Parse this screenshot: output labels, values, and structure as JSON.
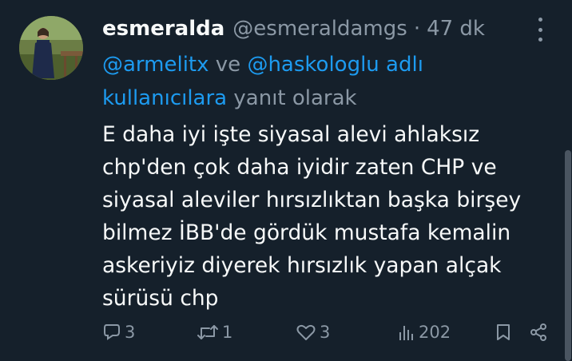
{
  "tweet": {
    "author": {
      "display_name": "esmeralda",
      "handle": "@esmeraldamgs",
      "separator": "·",
      "time": "47 dk"
    },
    "reply_context": {
      "mention_1": "@armelitx",
      "connector": " ve ",
      "mention_2": "@haskologlu adlı kullanıcılara",
      "suffix": " yanıt olarak"
    },
    "body_lines": [
      "E daha iyi işte siyasal alevi ahlaksız",
      "chp'den çok daha iyidir zaten CHP ve",
      "siyasal aleviler hırsızlıktan başka birşey",
      "bilmez İBB'de gördük mustafa kemalin",
      "askeriyiz diyerek hırsızlık yapan alçak",
      "sürüsü chp"
    ],
    "actions": {
      "replies": "3",
      "reposts": "1",
      "likes": "3",
      "views": "202"
    },
    "icons": {
      "reply": "speech-bubble-icon",
      "repost": "repost-arrows-icon",
      "like": "heart-icon",
      "views": "bar-chart-icon",
      "bookmark": "bookmark-icon",
      "share": "share-icon",
      "more": "three-dots-vertical-icon"
    },
    "colors": {
      "background": "#15202b",
      "primary_text": "#f7f9f9",
      "secondary_text": "#8b98a5",
      "link": "#1d9bf0"
    }
  }
}
